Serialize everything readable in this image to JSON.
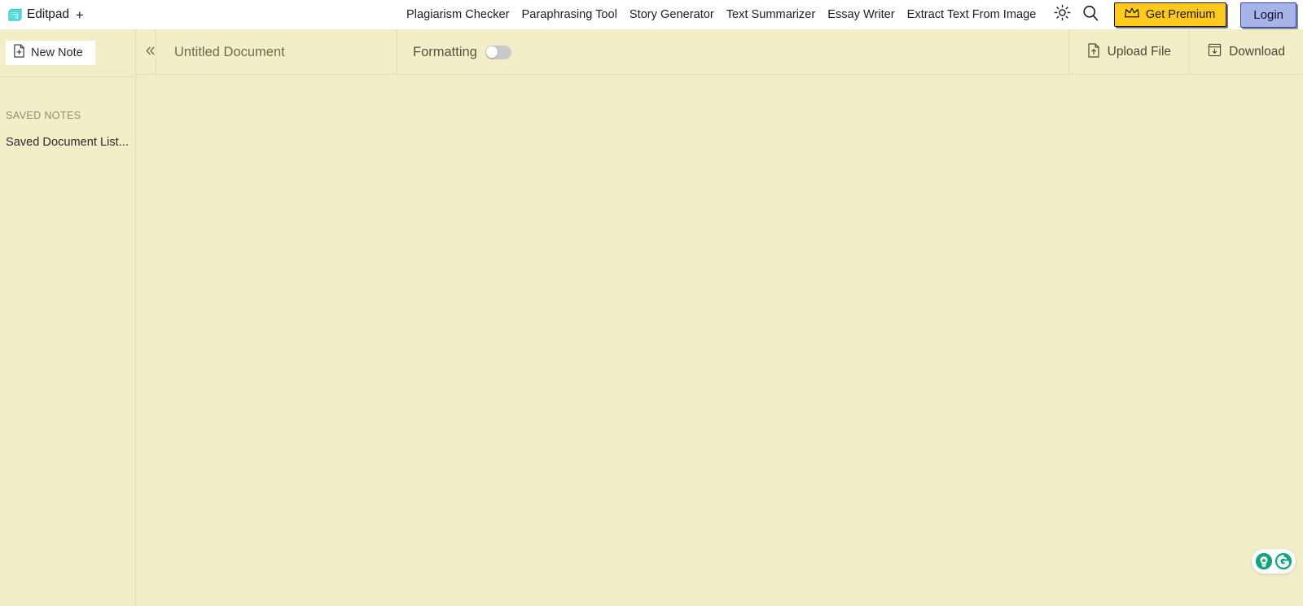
{
  "brand": {
    "name": "Editpad",
    "plus": "+",
    "logo_icon": "notepad-icon",
    "logo_color": "#5FE3E3"
  },
  "nav": {
    "links": [
      {
        "label": "Plagiarism Checker"
      },
      {
        "label": "Paraphrasing Tool"
      },
      {
        "label": "Story Generator"
      },
      {
        "label": "Text Summarizer"
      },
      {
        "label": "Essay Writer"
      },
      {
        "label": "Extract Text From Image"
      }
    ],
    "theme_toggle_icon": "sun-icon",
    "search_icon": "search-icon",
    "premium": {
      "label": "Get Premium",
      "icon": "crown-icon",
      "bg_color": "#FFC91E"
    },
    "login": {
      "label": "Login",
      "bg_color": "#A8B4E8",
      "border_color": "#2840B8"
    }
  },
  "sidebar": {
    "new_note": {
      "label": "New Note",
      "icon": "file-plus-icon"
    },
    "section_title": "SAVED NOTES",
    "items": [
      {
        "label": "Saved Document List...",
        "icon": "document-icon"
      }
    ]
  },
  "doc_header": {
    "collapse_icon": "chevron-double-left-icon",
    "title_value": "",
    "title_placeholder": "Untitled Document",
    "formatting": {
      "label": "Formatting",
      "enabled": false
    },
    "actions": [
      {
        "label": "Upload File",
        "icon": "file-upload-icon"
      },
      {
        "label": "Download",
        "icon": "download-box-icon"
      }
    ]
  },
  "editor": {
    "content": "",
    "placeholder": "",
    "bg_color": "#F2EFC8"
  },
  "grammarly": {
    "name": "Grammarly",
    "suggestion_icon": "lightbulb-icon",
    "logo_icon": "grammarly-g-icon",
    "accent_color": "#15A37F"
  }
}
